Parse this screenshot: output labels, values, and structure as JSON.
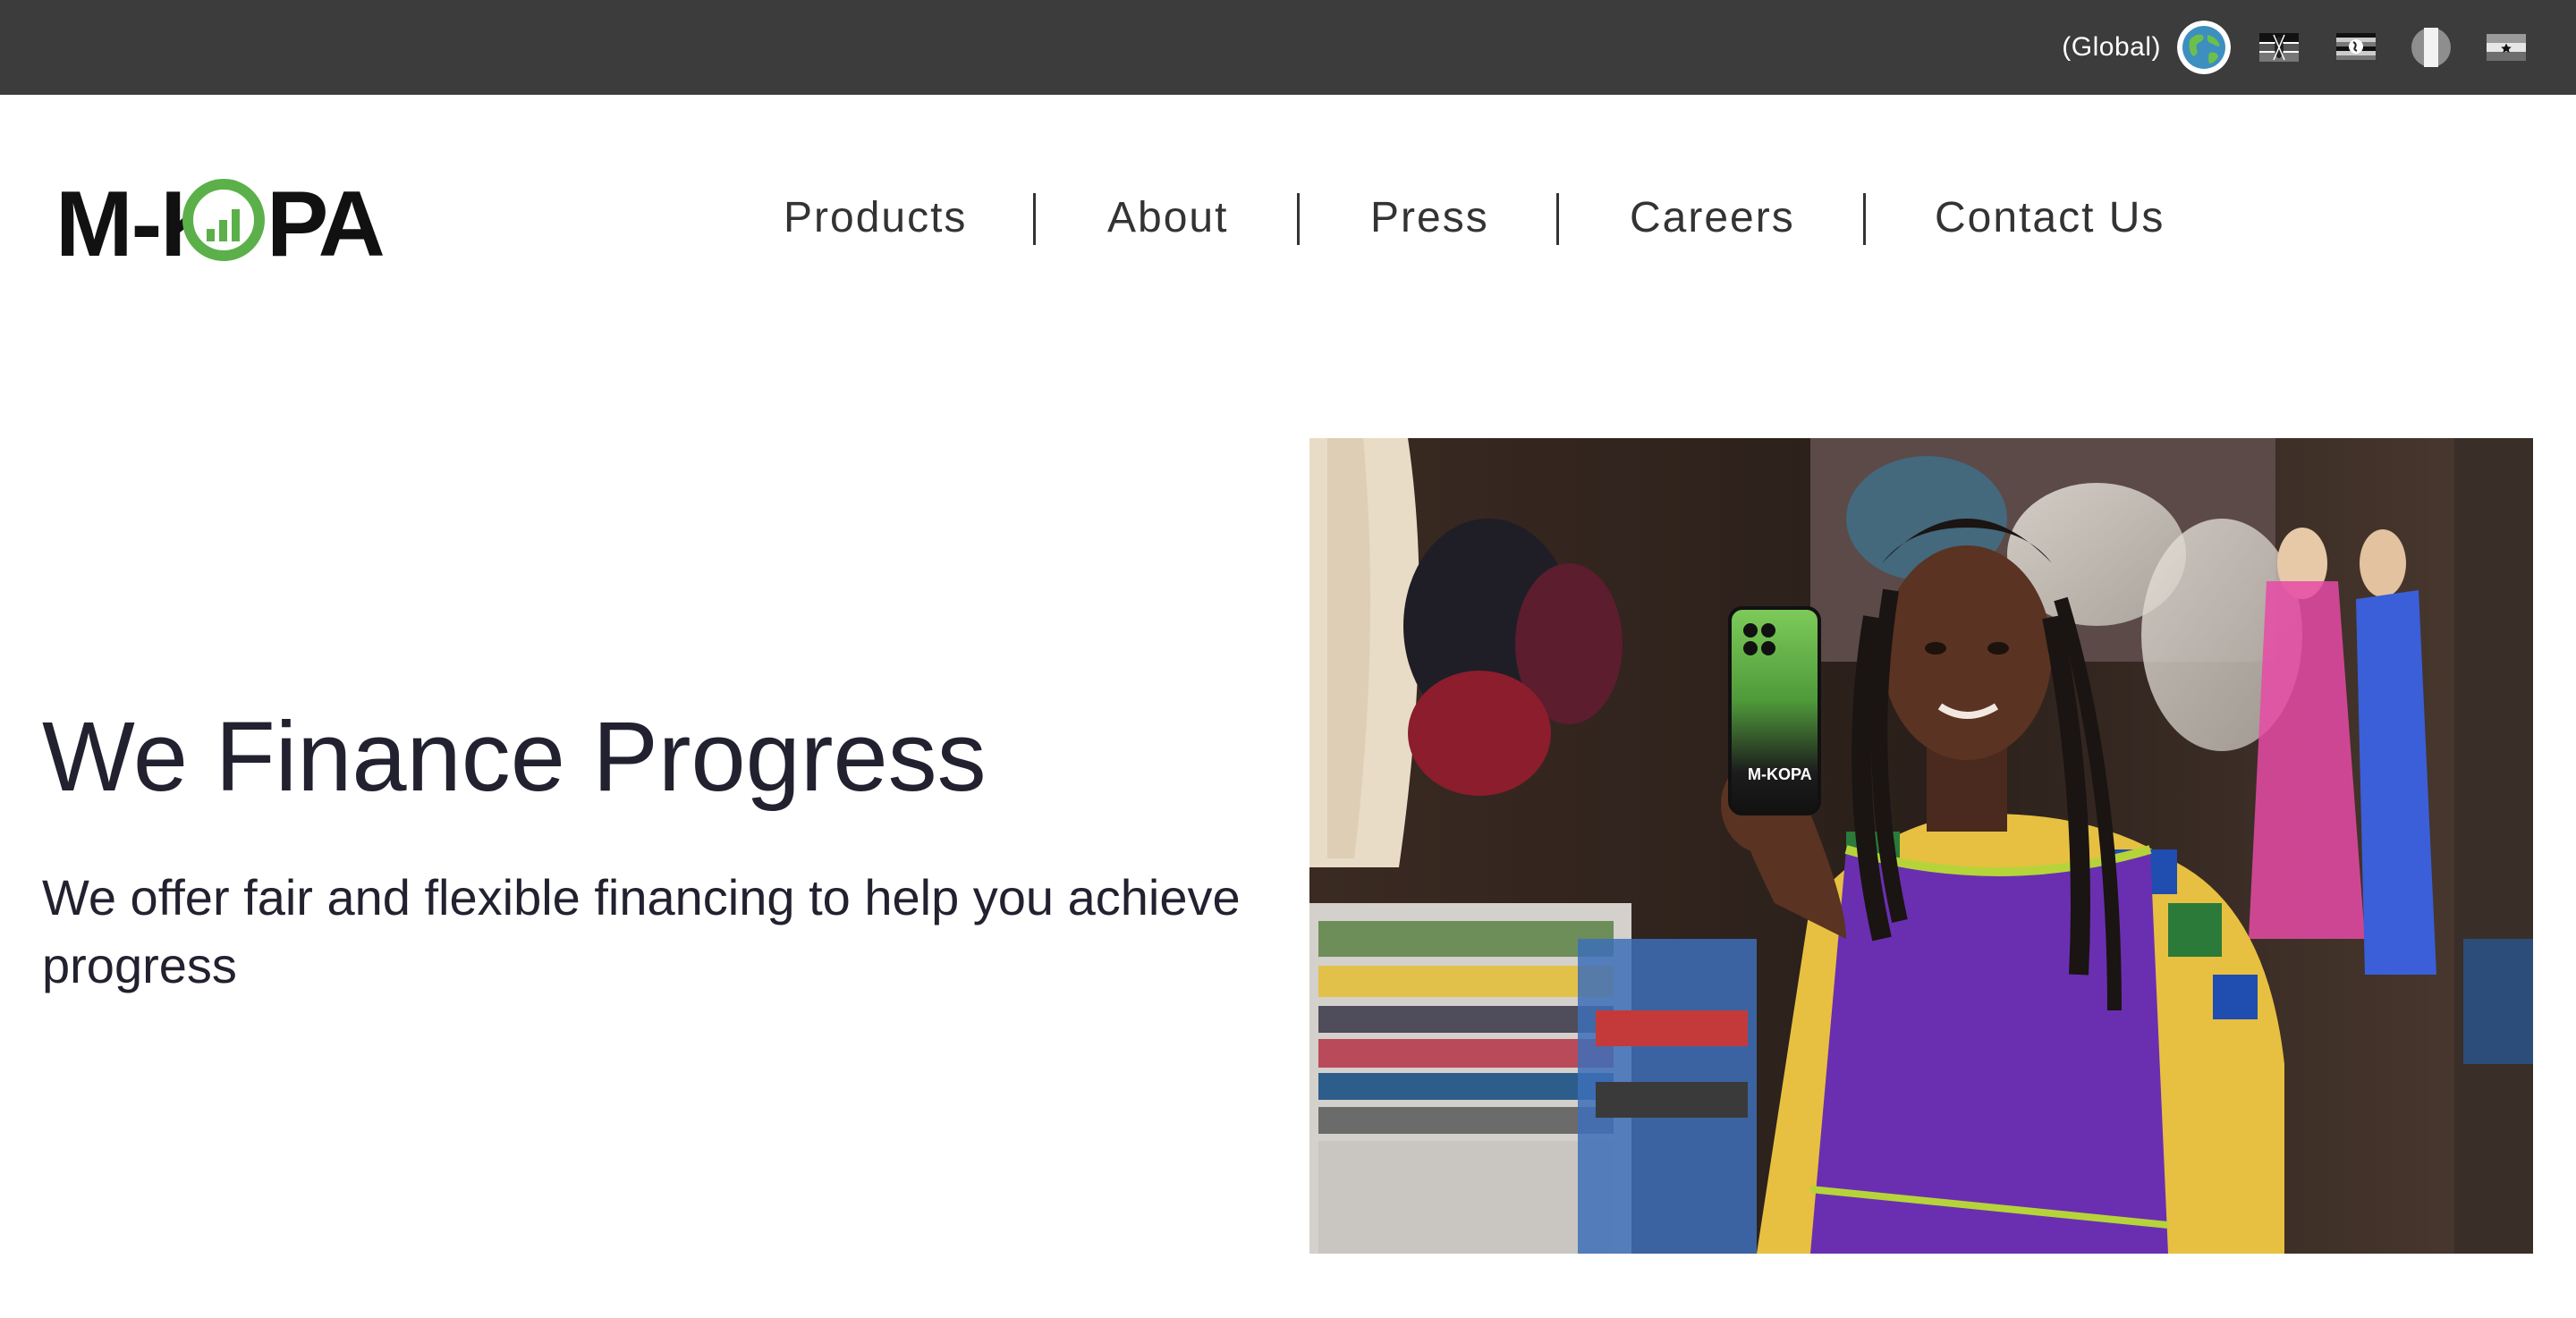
{
  "topbar": {
    "region_label": "(Global)",
    "flags": [
      {
        "name": "global-flag",
        "icon": "globe-icon"
      },
      {
        "name": "kenya-flag",
        "icon": "kenya-flag-icon"
      },
      {
        "name": "uganda-flag",
        "icon": "uganda-flag-icon"
      },
      {
        "name": "nigeria-flag",
        "icon": "nigeria-flag-icon"
      },
      {
        "name": "ghana-flag",
        "icon": "ghana-flag-icon"
      }
    ]
  },
  "header": {
    "logo_text": "M-KOPA",
    "nav": [
      {
        "label": "Products"
      },
      {
        "label": "About"
      },
      {
        "label": "Press"
      },
      {
        "label": "Careers"
      },
      {
        "label": "Contact Us"
      }
    ]
  },
  "hero": {
    "title": "We Finance Progress",
    "subtitle": "We offer fair and flexible financing to help you achieve progress",
    "image_icon": "photo-woman-holding-phone",
    "phone_text": "M-KOPA"
  },
  "colors": {
    "topbar_bg": "#3c3c3c",
    "brand_green": "#5bb04a",
    "text_dark": "#22212f",
    "apron_purple": "#6a2fb0"
  }
}
